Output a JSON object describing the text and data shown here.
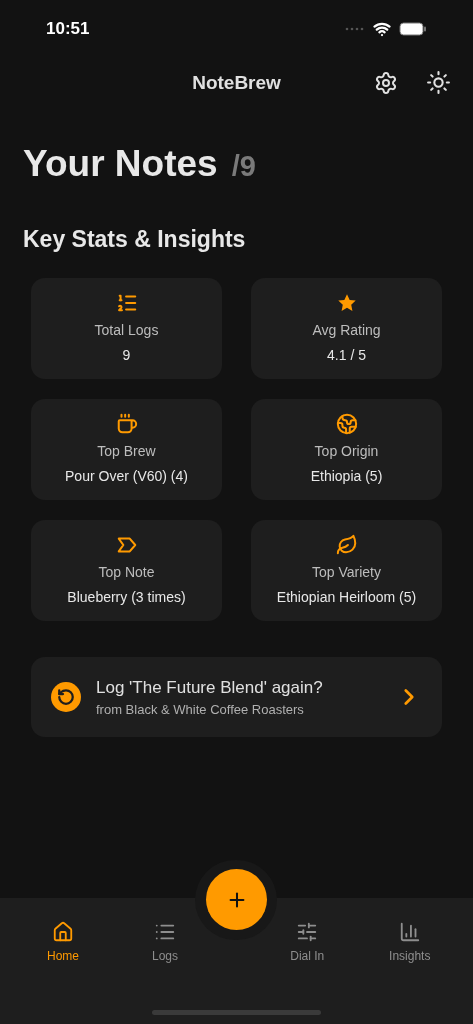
{
  "status_bar": {
    "time": "10:51"
  },
  "header": {
    "title": "NoteBrew"
  },
  "page": {
    "title": "Your Notes",
    "count": "/9"
  },
  "section_title": "Key Stats & Insights",
  "stats": [
    {
      "label": "Total Logs",
      "value": "9"
    },
    {
      "label": "Avg Rating",
      "value": "4.1 / 5"
    },
    {
      "label": "Top Brew",
      "value": "Pour Over (V60) (4)"
    },
    {
      "label": "Top Origin",
      "value": "Ethiopia (5)"
    },
    {
      "label": "Top Note",
      "value": "Blueberry (3 times)"
    },
    {
      "label": "Top Variety",
      "value": "Ethiopian Heirloom (5)"
    }
  ],
  "relog": {
    "title": "Log 'The Future Blend' again?",
    "subtitle": "from Black & White Coffee Roasters"
  },
  "nav": [
    {
      "label": "Home",
      "selected": true
    },
    {
      "label": "Logs",
      "selected": false
    },
    {
      "label": "Dial In",
      "selected": false
    },
    {
      "label": "Insights",
      "selected": false
    }
  ]
}
